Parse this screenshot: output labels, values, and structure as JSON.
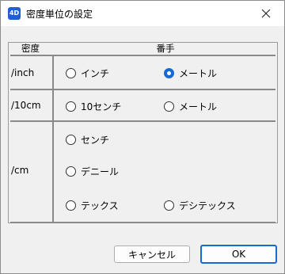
{
  "window": {
    "title": "密度単位の設定",
    "app_icon_text": "4D"
  },
  "table": {
    "header_left": "密度",
    "header_right": "番手",
    "rows": [
      {
        "label": "/inch",
        "options": [
          {
            "label": "インチ",
            "checked": false
          },
          {
            "label": "メートル",
            "checked": true
          }
        ]
      },
      {
        "label": "/10cm",
        "options": [
          {
            "label": "10センチ",
            "checked": false
          },
          {
            "label": "メートル",
            "checked": false
          }
        ]
      },
      {
        "label": "/cm",
        "options": [
          {
            "label": "センチ",
            "checked": false
          },
          {
            "label": "デニール",
            "checked": false
          },
          {
            "label": "テックス",
            "checked": false
          },
          {
            "label": "デシテックス",
            "checked": false
          }
        ]
      }
    ]
  },
  "buttons": {
    "cancel": "キャンセル",
    "ok": "OK"
  },
  "colors": {
    "accent": "#1769d6",
    "app_icon": "#1f5fd6"
  },
  "icons": {
    "app": "4d-app-icon",
    "close": "close-icon"
  }
}
